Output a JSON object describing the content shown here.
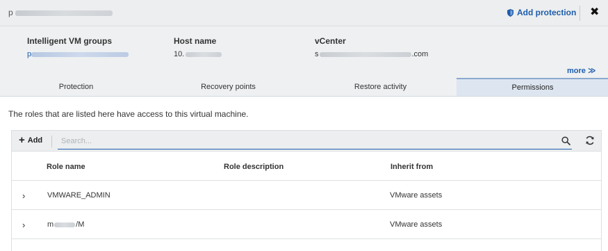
{
  "header": {
    "title_prefix": "p",
    "add_protection_label": "Add protection",
    "close_label": "✖"
  },
  "info": {
    "groups_label": "Intelligent VM groups",
    "groups_value_prefix": "p",
    "host_label": "Host name",
    "host_value_prefix": "10.",
    "vcenter_label": "vCenter",
    "vcenter_value_prefix": "s",
    "vcenter_value_suffix": ".com",
    "more_label": "more ≫"
  },
  "tabs": [
    {
      "label": "Protection",
      "active": false
    },
    {
      "label": "Recovery points",
      "active": false
    },
    {
      "label": "Restore activity",
      "active": false
    },
    {
      "label": "Permissions",
      "active": true
    }
  ],
  "description": "The roles that are listed here have access to this virtual machine.",
  "toolbar": {
    "add_label": "Add",
    "search_placeholder": "Search..."
  },
  "table": {
    "columns": [
      "Role name",
      "Role description",
      "Inherit from"
    ],
    "rows": [
      {
        "role_prefix": "VMWARE_ADMIN",
        "role_suffix": "",
        "description": "",
        "inherit": "VMware assets"
      },
      {
        "role_prefix": "m",
        "role_suffix": "/M",
        "description": "",
        "inherit": "VMware assets"
      }
    ]
  },
  "colors": {
    "accent": "#1d5dab",
    "header_bg": "#eceeef",
    "active_tab_bg": "#dde6f0"
  }
}
